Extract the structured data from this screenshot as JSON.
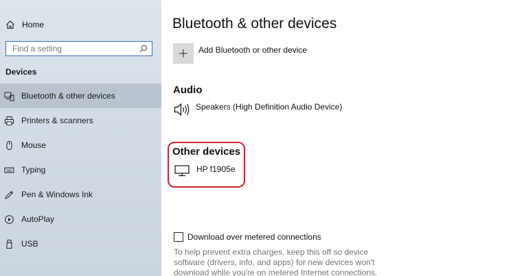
{
  "sidebar": {
    "home_label": "Home",
    "search": {
      "placeholder": "Find a setting",
      "value": ""
    },
    "section_title": "Devices",
    "items": [
      {
        "label": "Bluetooth & other devices",
        "icon": "bluetooth-devices-icon",
        "active": true
      },
      {
        "label": "Printers & scanners",
        "icon": "printer-icon",
        "active": false
      },
      {
        "label": "Mouse",
        "icon": "mouse-icon",
        "active": false
      },
      {
        "label": "Typing",
        "icon": "keyboard-icon",
        "active": false
      },
      {
        "label": "Pen & Windows Ink",
        "icon": "pen-icon",
        "active": false
      },
      {
        "label": "AutoPlay",
        "icon": "autoplay-icon",
        "active": false
      },
      {
        "label": "USB",
        "icon": "usb-icon",
        "active": false
      }
    ]
  },
  "main": {
    "title": "Bluetooth & other devices",
    "add_device_label": "Add Bluetooth or other device",
    "audio": {
      "title": "Audio",
      "devices": [
        {
          "name": "Speakers (High Definition Audio Device)",
          "icon": "speaker-icon"
        }
      ]
    },
    "other_devices": {
      "title": "Other devices",
      "devices": [
        {
          "name": "HP f1905e",
          "icon": "monitor-icon"
        }
      ]
    },
    "metered": {
      "label": "Download over metered connections",
      "checked": false,
      "help_text": "To help prevent extra charges, keep this off so device software (drivers, info, and apps) for new devices won't download while you're on metered Internet connections."
    }
  },
  "colors": {
    "highlight": "#cc2233",
    "search_border": "#3a6fb0",
    "active_item": "#a9b6c3"
  }
}
